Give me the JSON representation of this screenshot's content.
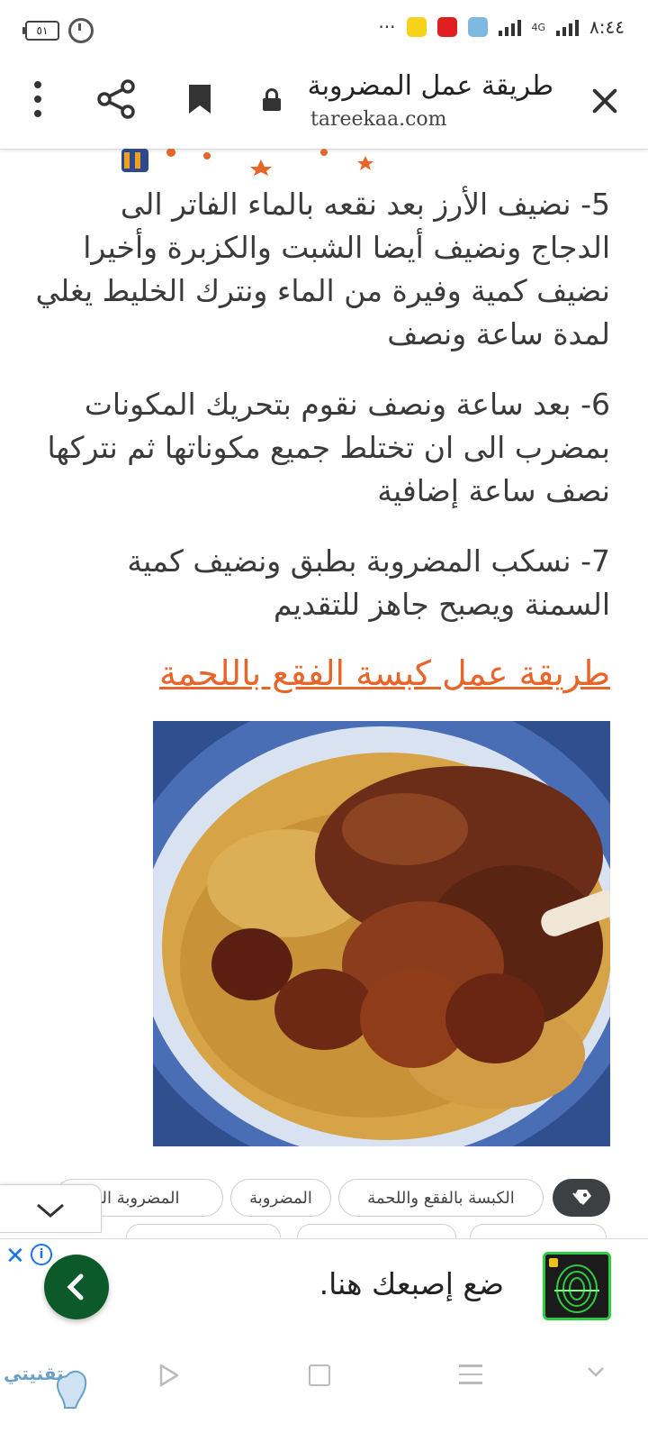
{
  "status_bar": {
    "time": "٨:٤٤",
    "network": "4G",
    "battery": "٥١",
    "more": "···"
  },
  "browser": {
    "page_title": "طريقة عمل المضروبة",
    "url": "tareekaa.com"
  },
  "article": {
    "steps": [
      "5- نضيف الأرز بعد نقعه بالماء الفاتر الى الدجاج ونضيف أيضا الشبت والكزبرة وأخيرا نضيف كمية وفيرة من الماء ونترك الخليط يغلي لمدة ساعة ونصف",
      "6- بعد ساعة ونصف نقوم بتحريك المكونات بمضرب الى ان تختلط جميع مكوناتها ثم نتركها نصف ساعة إضافية",
      "7- نسكب المضروبة بطبق ونضيف كمية السمنة ويصبح جاهز للتقديم"
    ],
    "section_link": "طريقة عمل كبسة الفقع باللحمة"
  },
  "tags": [
    "الكبسة بالفقع واللحمة",
    "المضروبة",
    "المضروبة البحرينية"
  ],
  "ad": {
    "text": "ضع إصبعك هنا.",
    "close": "✕",
    "info": "i"
  },
  "watermark": "تقنيتي",
  "colors": {
    "link": "#e8652a",
    "ad_button": "#0c5a2a",
    "ad_logo_border": "#2ecc40"
  }
}
